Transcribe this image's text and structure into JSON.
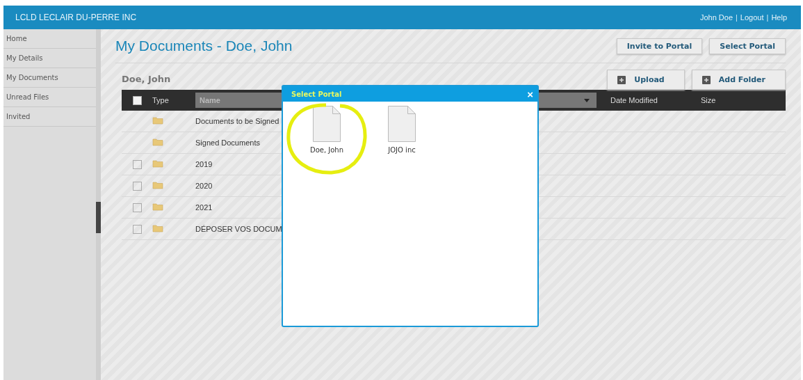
{
  "header": {
    "title": "LCLD LECLAIR DU-PERRE INC",
    "links": [
      "John Doe",
      "Logout",
      "Help"
    ],
    "separator": "|"
  },
  "sidebar": {
    "items": [
      {
        "label": "Home",
        "selected": false
      },
      {
        "label": "My Details",
        "selected": false
      },
      {
        "label": "My Documents",
        "selected": false
      },
      {
        "label": "Unread Files",
        "selected": false
      },
      {
        "label": "Invited",
        "selected": false
      }
    ]
  },
  "page": {
    "title": "My Documents - Doe, John",
    "buttons": [
      "Invite to Portal",
      "Select Portal"
    ]
  },
  "folder": {
    "title": "Doe, John",
    "buttons": [
      "Upload",
      "Add Folder"
    ]
  },
  "table": {
    "columns": [
      "Type",
      "Name",
      "Date Modified",
      "Size"
    ],
    "header_checked": false,
    "rows": [
      {
        "kind": "fixed",
        "name": "Documents to be Signed"
      },
      {
        "kind": "fixed",
        "name": "Signed Documents"
      },
      {
        "kind": "selectable",
        "name": "2019",
        "checked": false
      },
      {
        "kind": "selectable",
        "name": "2020",
        "checked": false
      },
      {
        "kind": "selectable",
        "name": "2021",
        "checked": false
      },
      {
        "kind": "selectable",
        "name": "DÉPOSER VOS DOCUM",
        "checked": false
      }
    ]
  },
  "modal": {
    "title": "Select Portal",
    "close": "×",
    "portals": [
      {
        "label": "Doe, John"
      },
      {
        "label": "JOJO inc"
      }
    ]
  },
  "annotation": {
    "kind": "circle"
  }
}
